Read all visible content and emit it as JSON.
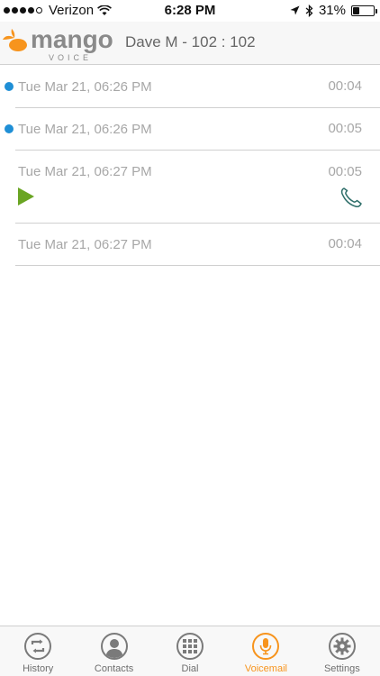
{
  "status_bar": {
    "carrier": "Verizon",
    "time": "6:28 PM",
    "battery_percent": "31%",
    "battery_level": 0.31,
    "signal_bars_filled": 4,
    "signal_bars_total": 5,
    "icons": [
      "wifi-icon",
      "location-arrow-icon",
      "bluetooth-icon",
      "battery-icon"
    ]
  },
  "header": {
    "logo_word": "mango",
    "logo_sub": "VOICE",
    "title": "Dave M - 102 : 102"
  },
  "voicemails": [
    {
      "date": "Tue Mar 21, 06:26 PM",
      "duration": "00:04",
      "unread": true,
      "expanded": false
    },
    {
      "date": "Tue Mar 21, 06:26 PM",
      "duration": "00:05",
      "unread": true,
      "expanded": false
    },
    {
      "date": "Tue Mar 21, 06:27 PM",
      "duration": "00:05",
      "unread": false,
      "expanded": true
    },
    {
      "date": "Tue Mar 21, 06:27 PM",
      "duration": "00:04",
      "unread": false,
      "expanded": false
    }
  ],
  "tabs": [
    {
      "label": "History",
      "icon": "history-icon",
      "active": false
    },
    {
      "label": "Contacts",
      "icon": "contacts-icon",
      "active": false
    },
    {
      "label": "Dial",
      "icon": "dialpad-icon",
      "active": false
    },
    {
      "label": "Voicemail",
      "icon": "microphone-icon",
      "active": true
    },
    {
      "label": "Settings",
      "icon": "gear-icon",
      "active": false
    }
  ],
  "colors": {
    "accent": "#f7941d",
    "unread_dot": "#1f8fd6",
    "play": "#6aa523",
    "callback": "#2f6f6a"
  }
}
